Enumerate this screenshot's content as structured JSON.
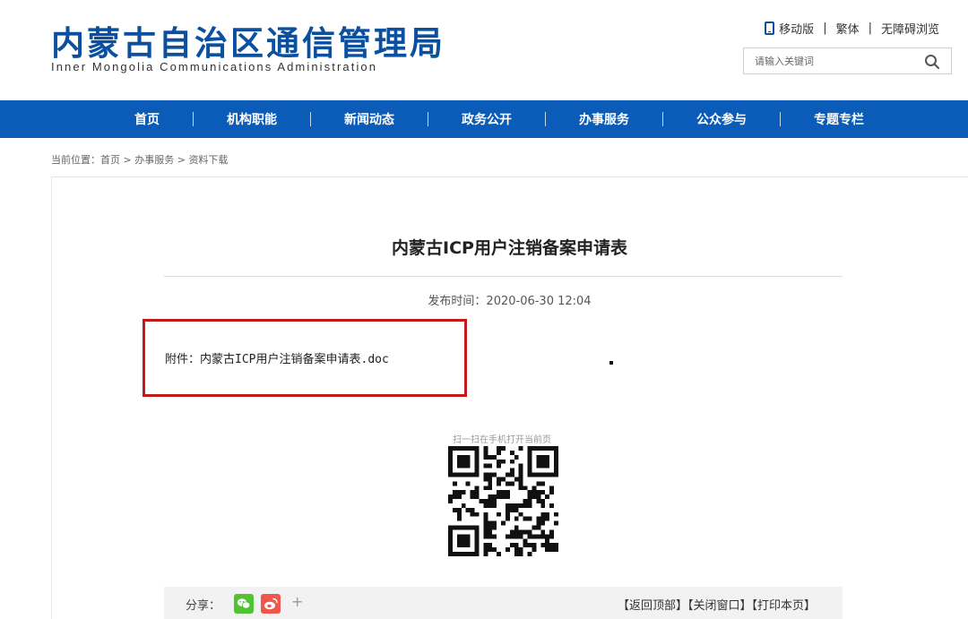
{
  "header": {
    "logo_cn": "内蒙古自治区通信管理局",
    "logo_en": "Inner Mongolia Communications Administration",
    "links": {
      "mobile": "移动版",
      "traditional": "繁体",
      "accessible": "无障碍浏览"
    },
    "separator": "|",
    "search_placeholder": "请输入关键词"
  },
  "nav": {
    "items": [
      "首页",
      "机构职能",
      "新闻动态",
      "政务公开",
      "办事服务",
      "公众参与",
      "专题专栏"
    ]
  },
  "breadcrumb": {
    "prefix": "当前位置：",
    "items": [
      "首页",
      "办事服务",
      "资料下载"
    ],
    "sep": " > "
  },
  "article": {
    "title": "内蒙古ICP用户注销备案申请表",
    "publish_time": "发布时间：2020-06-30 12:04",
    "attachment_label": "附件：",
    "attachment_file": "内蒙古ICP用户注销备案申请表.doc"
  },
  "qr": {
    "label": "扫一扫在手机打开当前页"
  },
  "footer": {
    "share_label": "分享：",
    "plus": "+",
    "back_top": "【返回顶部】",
    "close_window": "【关闭窗口】",
    "print_page": "【打印本页】"
  },
  "colors": {
    "brand": "#0b4f9f",
    "nav_bg": "#0b5cb8",
    "highlight": "#c4191a",
    "wechat": "#51c332",
    "weibo": "#f0574c"
  },
  "icons": [
    "phone-icon",
    "search-icon",
    "wechat-icon",
    "weibo-icon",
    "qr-code"
  ]
}
